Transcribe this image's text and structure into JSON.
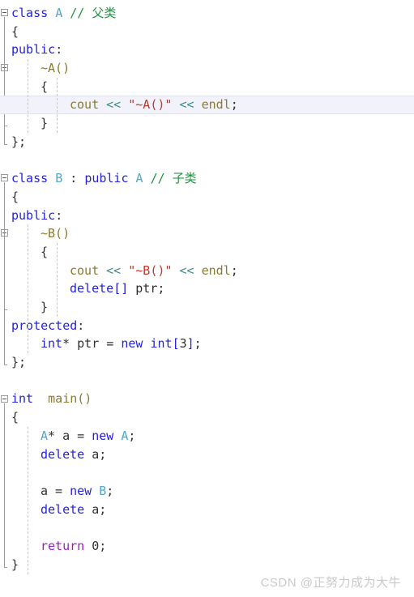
{
  "editor": {
    "language": "cpp",
    "highlighted_line_number": 6,
    "colors": {
      "keyword": "#2323dc",
      "type_name": "#4fa8cc",
      "comment": "#1d9440",
      "function": "#8a7a32",
      "string": "#c0392b",
      "operator": "#3f8c8c",
      "return_keyword": "#a020c0",
      "plain": "#303030",
      "background": "#ffffff",
      "highlight_row": "#f2f2fa"
    },
    "lines": [
      {
        "n": 1,
        "indent": 0,
        "tokens": [
          {
            "t": "class ",
            "c": "kw"
          },
          {
            "t": "A",
            "c": "typ"
          },
          {
            "t": " ",
            "c": "pln"
          },
          {
            "t": "// 父类",
            "c": "cmt"
          }
        ]
      },
      {
        "n": 2,
        "indent": 0,
        "tokens": [
          {
            "t": "{",
            "c": "br"
          }
        ]
      },
      {
        "n": 3,
        "indent": 0,
        "tokens": [
          {
            "t": "public",
            "c": "kw"
          },
          {
            "t": ":",
            "c": "pln"
          }
        ]
      },
      {
        "n": 4,
        "indent": 1,
        "tokens": [
          {
            "t": "~A()",
            "c": "fn"
          }
        ]
      },
      {
        "n": 5,
        "indent": 1,
        "tokens": [
          {
            "t": "{",
            "c": "br"
          }
        ]
      },
      {
        "n": 6,
        "indent": 2,
        "highlight": true,
        "tokens": [
          {
            "t": "cout",
            "c": "fn"
          },
          {
            "t": " ",
            "c": "pln"
          },
          {
            "t": "<<",
            "c": "op"
          },
          {
            "t": " ",
            "c": "pln"
          },
          {
            "t": "\"~A()\"",
            "c": "str"
          },
          {
            "t": " ",
            "c": "pln"
          },
          {
            "t": "<<",
            "c": "op"
          },
          {
            "t": " ",
            "c": "pln"
          },
          {
            "t": "endl",
            "c": "fn"
          },
          {
            "t": ";",
            "c": "pln"
          }
        ]
      },
      {
        "n": 7,
        "indent": 1,
        "tokens": [
          {
            "t": "}",
            "c": "br"
          }
        ]
      },
      {
        "n": 8,
        "indent": 0,
        "tokens": [
          {
            "t": "};",
            "c": "br"
          }
        ]
      },
      {
        "n": 9,
        "indent": 0,
        "tokens": []
      },
      {
        "n": 10,
        "indent": 0,
        "tokens": [
          {
            "t": "class ",
            "c": "kw"
          },
          {
            "t": "B",
            "c": "typ"
          },
          {
            "t": " : ",
            "c": "pln"
          },
          {
            "t": "public ",
            "c": "kw"
          },
          {
            "t": "A",
            "c": "typ"
          },
          {
            "t": " ",
            "c": "pln"
          },
          {
            "t": "// 子类",
            "c": "cmt"
          }
        ]
      },
      {
        "n": 11,
        "indent": 0,
        "tokens": [
          {
            "t": "{",
            "c": "br"
          }
        ]
      },
      {
        "n": 12,
        "indent": 0,
        "tokens": [
          {
            "t": "public",
            "c": "kw"
          },
          {
            "t": ":",
            "c": "pln"
          }
        ]
      },
      {
        "n": 13,
        "indent": 1,
        "tokens": [
          {
            "t": "~B()",
            "c": "fn"
          }
        ]
      },
      {
        "n": 14,
        "indent": 1,
        "tokens": [
          {
            "t": "{",
            "c": "br"
          }
        ]
      },
      {
        "n": 15,
        "indent": 2,
        "tokens": [
          {
            "t": "cout",
            "c": "fn"
          },
          {
            "t": " ",
            "c": "pln"
          },
          {
            "t": "<<",
            "c": "op"
          },
          {
            "t": " ",
            "c": "pln"
          },
          {
            "t": "\"~B()\"",
            "c": "str"
          },
          {
            "t": " ",
            "c": "pln"
          },
          {
            "t": "<<",
            "c": "op"
          },
          {
            "t": " ",
            "c": "pln"
          },
          {
            "t": "endl",
            "c": "fn"
          },
          {
            "t": ";",
            "c": "pln"
          }
        ]
      },
      {
        "n": 16,
        "indent": 2,
        "tokens": [
          {
            "t": "delete",
            "c": "kw"
          },
          {
            "t": "[] ",
            "c": "kw"
          },
          {
            "t": "ptr;",
            "c": "pln"
          }
        ]
      },
      {
        "n": 17,
        "indent": 1,
        "tokens": [
          {
            "t": "}",
            "c": "br"
          }
        ]
      },
      {
        "n": 18,
        "indent": 0,
        "tokens": [
          {
            "t": "protected",
            "c": "kw"
          },
          {
            "t": ":",
            "c": "pln"
          }
        ]
      },
      {
        "n": 19,
        "indent": 1,
        "tokens": [
          {
            "t": "int",
            "c": "kw"
          },
          {
            "t": "* ptr = ",
            "c": "pln"
          },
          {
            "t": "new ",
            "c": "kw"
          },
          {
            "t": "int",
            "c": "kw"
          },
          {
            "t": "[",
            "c": "kw"
          },
          {
            "t": "3",
            "c": "num"
          },
          {
            "t": "]",
            "c": "kw"
          },
          {
            "t": ";",
            "c": "pln"
          }
        ]
      },
      {
        "n": 20,
        "indent": 0,
        "tokens": [
          {
            "t": "};",
            "c": "br"
          }
        ]
      },
      {
        "n": 21,
        "indent": 0,
        "tokens": []
      },
      {
        "n": 22,
        "indent": 0,
        "tokens": [
          {
            "t": "int",
            "c": "kw"
          },
          {
            "t": "  ",
            "c": "pln"
          },
          {
            "t": "main()",
            "c": "fn"
          }
        ]
      },
      {
        "n": 23,
        "indent": 0,
        "tokens": [
          {
            "t": "{",
            "c": "br"
          }
        ]
      },
      {
        "n": 24,
        "indent": 1,
        "tokens": [
          {
            "t": "A",
            "c": "typ"
          },
          {
            "t": "* a = ",
            "c": "pln"
          },
          {
            "t": "new ",
            "c": "kw"
          },
          {
            "t": "A",
            "c": "typ"
          },
          {
            "t": ";",
            "c": "pln"
          }
        ]
      },
      {
        "n": 25,
        "indent": 1,
        "tokens": [
          {
            "t": "delete",
            "c": "kw"
          },
          {
            "t": " a;",
            "c": "pln"
          }
        ]
      },
      {
        "n": 26,
        "indent": 1,
        "tokens": []
      },
      {
        "n": 27,
        "indent": 1,
        "tokens": [
          {
            "t": "a = ",
            "c": "pln"
          },
          {
            "t": "new ",
            "c": "kw"
          },
          {
            "t": "B",
            "c": "typ"
          },
          {
            "t": ";",
            "c": "pln"
          }
        ]
      },
      {
        "n": 28,
        "indent": 1,
        "tokens": [
          {
            "t": "delete",
            "c": "kw"
          },
          {
            "t": " a;",
            "c": "pln"
          }
        ]
      },
      {
        "n": 29,
        "indent": 1,
        "tokens": []
      },
      {
        "n": 30,
        "indent": 1,
        "tokens": [
          {
            "t": "return",
            "c": "ret"
          },
          {
            "t": " ",
            "c": "pln"
          },
          {
            "t": "0",
            "c": "num"
          },
          {
            "t": ";",
            "c": "pln"
          }
        ]
      },
      {
        "n": 31,
        "indent": 0,
        "tokens": [
          {
            "t": "}",
            "c": "br"
          }
        ]
      }
    ],
    "fold_markers": [
      {
        "name": "fold-class-a",
        "line": 1,
        "collapsed": false
      },
      {
        "name": "fold-dtor-a",
        "line": 4,
        "collapsed": false
      },
      {
        "name": "fold-class-b",
        "line": 10,
        "collapsed": false
      },
      {
        "name": "fold-dtor-b",
        "line": 13,
        "collapsed": false
      },
      {
        "name": "fold-main",
        "line": 22,
        "collapsed": false
      }
    ]
  },
  "watermark": {
    "text": "CSDN @正努力成为大牛"
  }
}
